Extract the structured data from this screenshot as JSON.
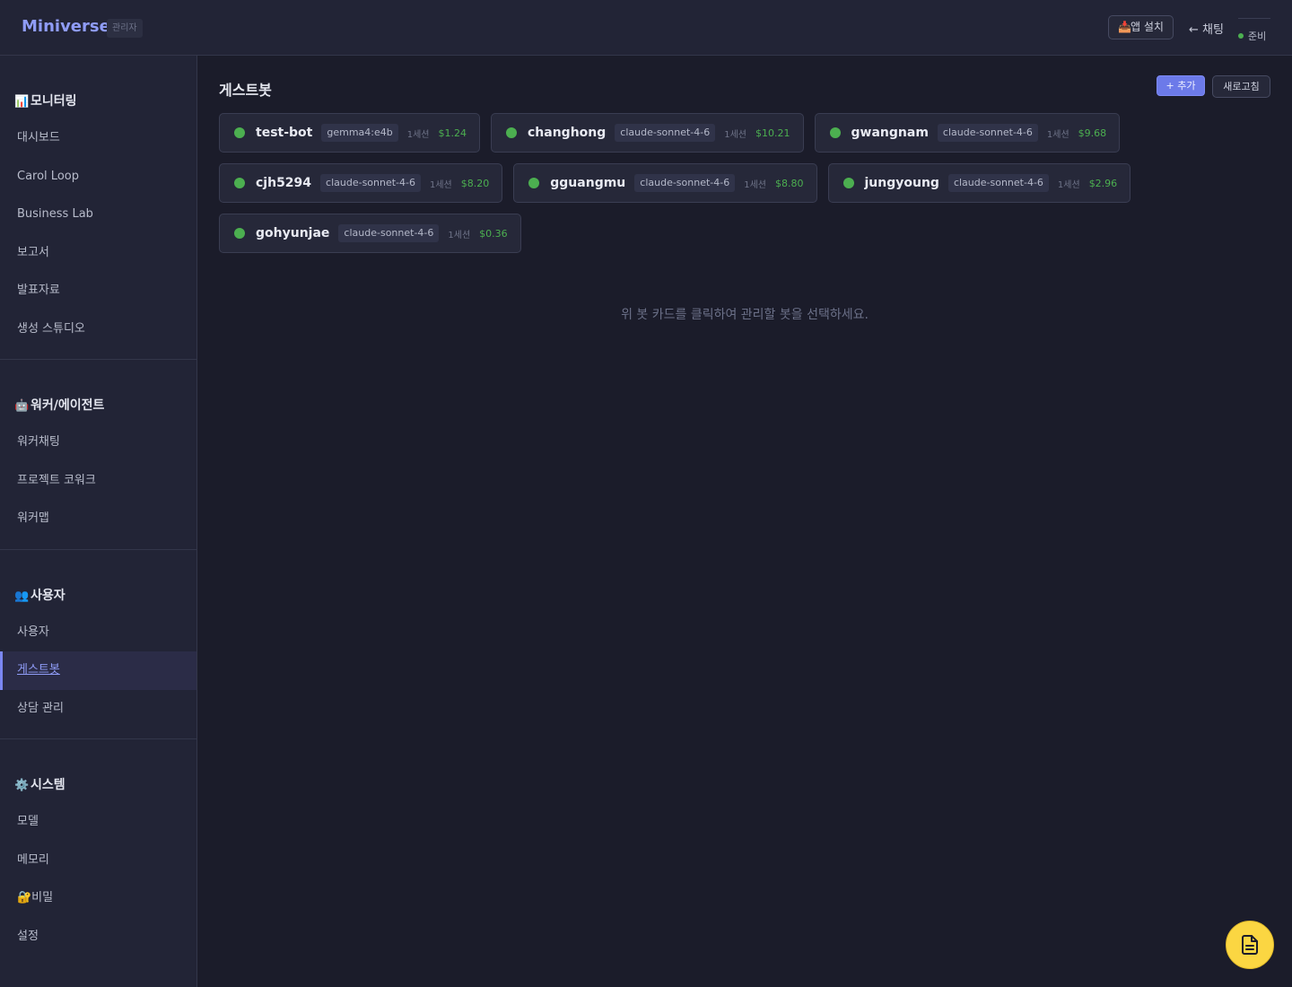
{
  "topbar": {
    "brand": "Miniverse",
    "role_badge": "관리자",
    "install_label": "앱 설치",
    "install_icon": "📥",
    "chat_label": "← 채팅",
    "status_label": "준비",
    "status_color": "#4caf50"
  },
  "sidebar": {
    "sections": [
      {
        "icon": "📊",
        "title": "모니터링",
        "items": [
          "대시보드",
          "Carol Loop",
          "Business Lab",
          "보고서",
          "발표자료",
          "생성 스튜디오"
        ]
      },
      {
        "icon": "🤖",
        "title": "워커/에이전트",
        "items": [
          "워커채팅",
          "프로젝트 코워크",
          "워커맵"
        ]
      },
      {
        "icon": "👥",
        "title": "사용자",
        "items": [
          "사용자",
          "게스트봇",
          "상담 관리"
        ]
      },
      {
        "icon": "⚙️",
        "title": "시스템",
        "items": [
          "모델",
          "메모리",
          "🔐비밀",
          "설정"
        ]
      }
    ],
    "active_item": "게스트봇"
  },
  "main": {
    "title": "게스트봇",
    "add_label": "+ 추가",
    "refresh_label": "새로고침",
    "empty_hint": "위 봇 카드를 클릭하여 관리할 봇을 선택하세요.",
    "bots": [
      {
        "name": "test-bot",
        "model": "gemma4:e4b",
        "sessions": "1세션",
        "cost": "$1.24"
      },
      {
        "name": "changhong",
        "model": "claude-sonnet-4-6",
        "sessions": "1세션",
        "cost": "$10.21"
      },
      {
        "name": "gwangnam",
        "model": "claude-sonnet-4-6",
        "sessions": "1세션",
        "cost": "$9.68"
      },
      {
        "name": "cjh5294",
        "model": "claude-sonnet-4-6",
        "sessions": "1세션",
        "cost": "$8.20"
      },
      {
        "name": "gguangmu",
        "model": "claude-sonnet-4-6",
        "sessions": "1세션",
        "cost": "$8.80"
      },
      {
        "name": "jungyoung",
        "model": "claude-sonnet-4-6",
        "sessions": "1세션",
        "cost": "$2.96"
      },
      {
        "name": "gohyunjae",
        "model": "claude-sonnet-4-6",
        "sessions": "1세션",
        "cost": "$0.36"
      }
    ]
  },
  "fab": {
    "icon": "document-icon",
    "color": "#fbd642"
  }
}
